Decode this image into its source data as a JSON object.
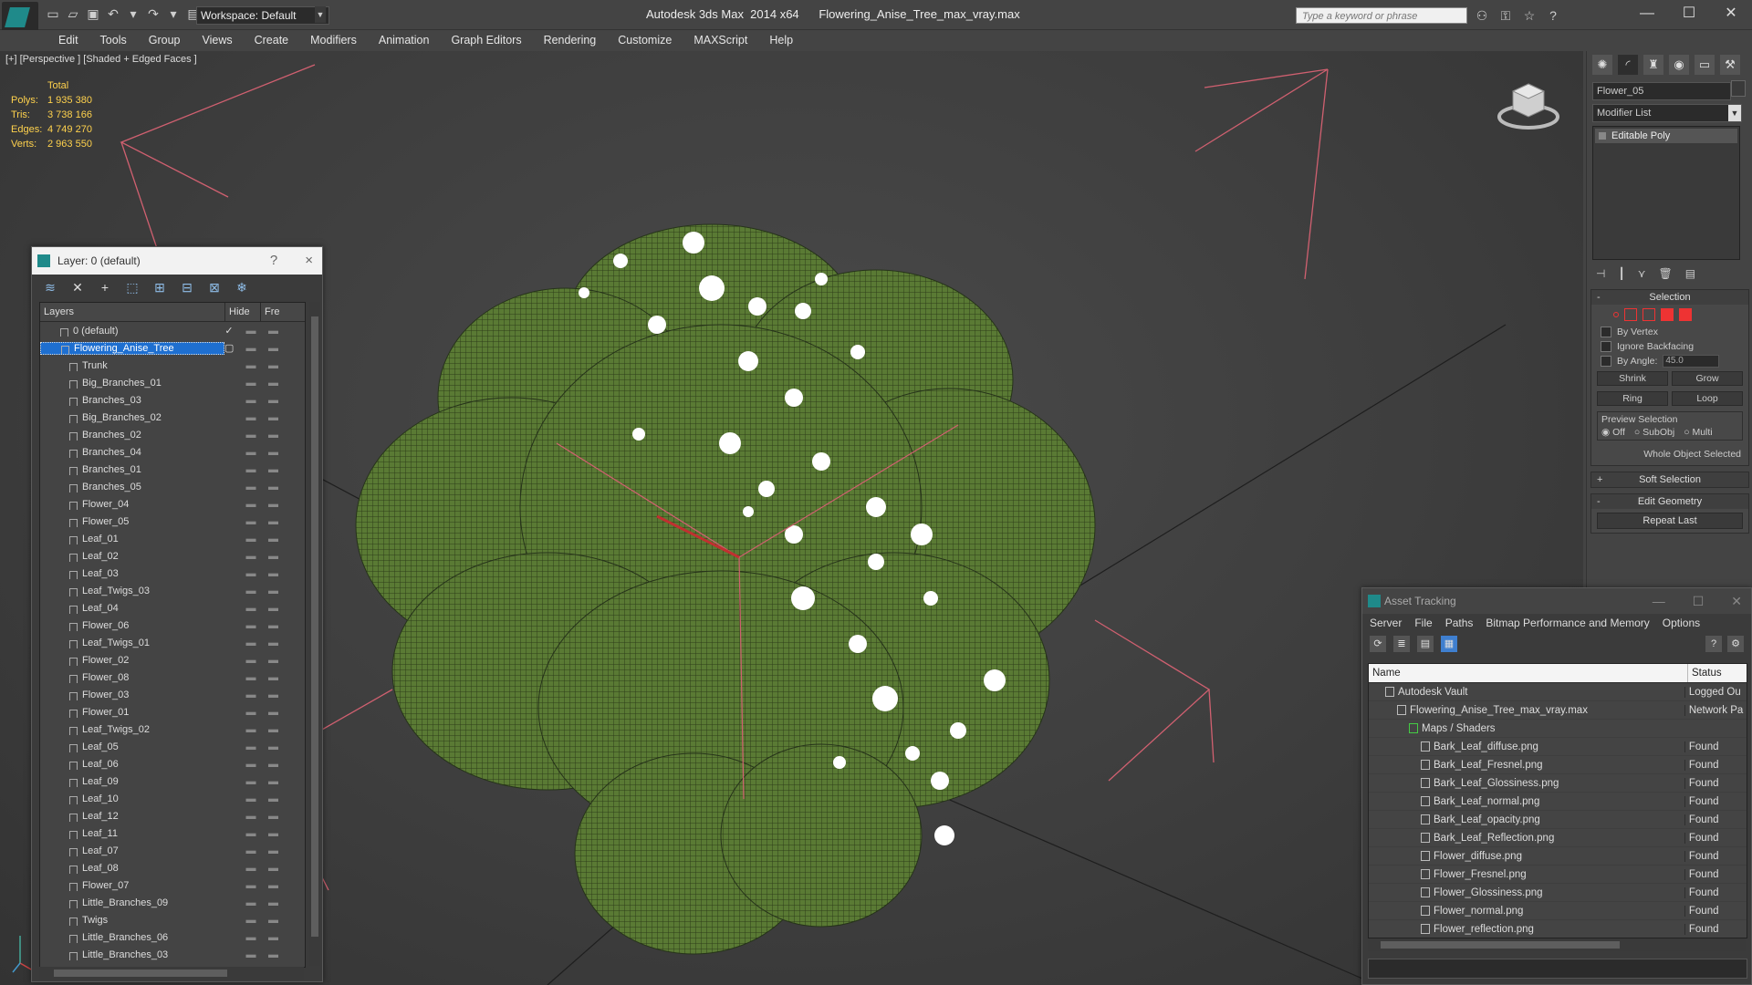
{
  "titlebar": {
    "workspace": "Workspace: Default",
    "app_name": "Autodesk 3ds Max  2014 x64",
    "file_name": "Flowering_Anise_Tree_max_vray.max",
    "search_placeholder": "Type a keyword or phrase"
  },
  "menu": [
    "Edit",
    "Tools",
    "Group",
    "Views",
    "Create",
    "Modifiers",
    "Animation",
    "Graph Editors",
    "Rendering",
    "Customize",
    "MAXScript",
    "Help"
  ],
  "viewport": {
    "label": "[+] [Perspective ] [Shaded + Edged Faces ]",
    "stats": {
      "header": "Total",
      "rows": [
        {
          "k": "Polys:",
          "v": "1 935 380"
        },
        {
          "k": "Tris:",
          "v": "3 738 166"
        },
        {
          "k": "Edges:",
          "v": "4 749 270"
        },
        {
          "k": "Verts:",
          "v": "2 963 550"
        }
      ]
    }
  },
  "layer_panel": {
    "title": "Layer: 0 (default)",
    "help": "?",
    "close": "×",
    "columns": {
      "layers": "Layers",
      "hide": "Hide",
      "freeze": "Fre"
    },
    "rows": [
      {
        "name": "0 (default)",
        "level": 0,
        "selected": false,
        "mark": "✓"
      },
      {
        "name": "Flowering_Anise_Tree",
        "level": 0,
        "selected": true,
        "mark": "▢"
      },
      {
        "name": "Trunk",
        "level": 1
      },
      {
        "name": "Big_Branches_01",
        "level": 1
      },
      {
        "name": "Branches_03",
        "level": 1
      },
      {
        "name": "Big_Branches_02",
        "level": 1
      },
      {
        "name": "Branches_02",
        "level": 1
      },
      {
        "name": "Branches_04",
        "level": 1
      },
      {
        "name": "Branches_01",
        "level": 1
      },
      {
        "name": "Branches_05",
        "level": 1
      },
      {
        "name": "Flower_04",
        "level": 1
      },
      {
        "name": "Flower_05",
        "level": 1
      },
      {
        "name": "Leaf_01",
        "level": 1
      },
      {
        "name": "Leaf_02",
        "level": 1
      },
      {
        "name": "Leaf_03",
        "level": 1
      },
      {
        "name": "Leaf_Twigs_03",
        "level": 1
      },
      {
        "name": "Leaf_04",
        "level": 1
      },
      {
        "name": "Flower_06",
        "level": 1
      },
      {
        "name": "Leaf_Twigs_01",
        "level": 1
      },
      {
        "name": "Flower_02",
        "level": 1
      },
      {
        "name": "Flower_08",
        "level": 1
      },
      {
        "name": "Flower_03",
        "level": 1
      },
      {
        "name": "Flower_01",
        "level": 1
      },
      {
        "name": "Leaf_Twigs_02",
        "level": 1
      },
      {
        "name": "Leaf_05",
        "level": 1
      },
      {
        "name": "Leaf_06",
        "level": 1
      },
      {
        "name": "Leaf_09",
        "level": 1
      },
      {
        "name": "Leaf_10",
        "level": 1
      },
      {
        "name": "Leaf_12",
        "level": 1
      },
      {
        "name": "Leaf_11",
        "level": 1
      },
      {
        "name": "Leaf_07",
        "level": 1
      },
      {
        "name": "Leaf_08",
        "level": 1
      },
      {
        "name": "Flower_07",
        "level": 1
      },
      {
        "name": "Little_Branches_09",
        "level": 1
      },
      {
        "name": "Twigs",
        "level": 1
      },
      {
        "name": "Little_Branches_06",
        "level": 1
      },
      {
        "name": "Little_Branches_03",
        "level": 1
      }
    ]
  },
  "command_panel": {
    "object_name": "Flower_05",
    "modifier_list": "Modifier List",
    "stack_items": [
      "Editable Poly"
    ],
    "selection": {
      "title": "Selection",
      "by_vertex": "By Vertex",
      "ignore_backfacing": "Ignore Backfacing",
      "by_angle": "By Angle:",
      "angle_value": "45.0",
      "shrink": "Shrink",
      "grow": "Grow",
      "ring": "Ring",
      "loop": "Loop",
      "preview_title": "Preview Selection",
      "preview_options": [
        "Off",
        "SubObj",
        "Multi"
      ],
      "status": "Whole Object Selected"
    },
    "soft_selection": "Soft Selection",
    "edit_geometry": "Edit Geometry",
    "repeat_last": "Repeat Last"
  },
  "asset_panel": {
    "title": "Asset Tracking",
    "menu": [
      "Server",
      "File",
      "Paths",
      "Bitmap Performance and Memory",
      "Options"
    ],
    "columns": {
      "name": "Name",
      "status": "Status"
    },
    "rows": [
      {
        "name": "Autodesk Vault",
        "indent": 0,
        "status": "Logged Ou"
      },
      {
        "name": "Flowering_Anise_Tree_max_vray.max",
        "indent": 1,
        "status": "Network Pa"
      },
      {
        "name": "Maps / Shaders",
        "indent": 2,
        "status": ""
      },
      {
        "name": "Bark_Leaf_diffuse.png",
        "indent": 3,
        "status": "Found"
      },
      {
        "name": "Bark_Leaf_Fresnel.png",
        "indent": 3,
        "status": "Found"
      },
      {
        "name": "Bark_Leaf_Glossiness.png",
        "indent": 3,
        "status": "Found"
      },
      {
        "name": "Bark_Leaf_normal.png",
        "indent": 3,
        "status": "Found"
      },
      {
        "name": "Bark_Leaf_opacity.png",
        "indent": 3,
        "status": "Found"
      },
      {
        "name": "Bark_Leaf_Reflection.png",
        "indent": 3,
        "status": "Found"
      },
      {
        "name": "Flower_diffuse.png",
        "indent": 3,
        "status": "Found"
      },
      {
        "name": "Flower_Fresnel.png",
        "indent": 3,
        "status": "Found"
      },
      {
        "name": "Flower_Glossiness.png",
        "indent": 3,
        "status": "Found"
      },
      {
        "name": "Flower_normal.png",
        "indent": 3,
        "status": "Found"
      },
      {
        "name": "Flower_reflection.png",
        "indent": 3,
        "status": "Found"
      }
    ]
  },
  "colors": {
    "accent": "#1e6fd0",
    "stats": "#ffd24d",
    "foliage": "#4f6b2e",
    "selection": "#e33333"
  }
}
